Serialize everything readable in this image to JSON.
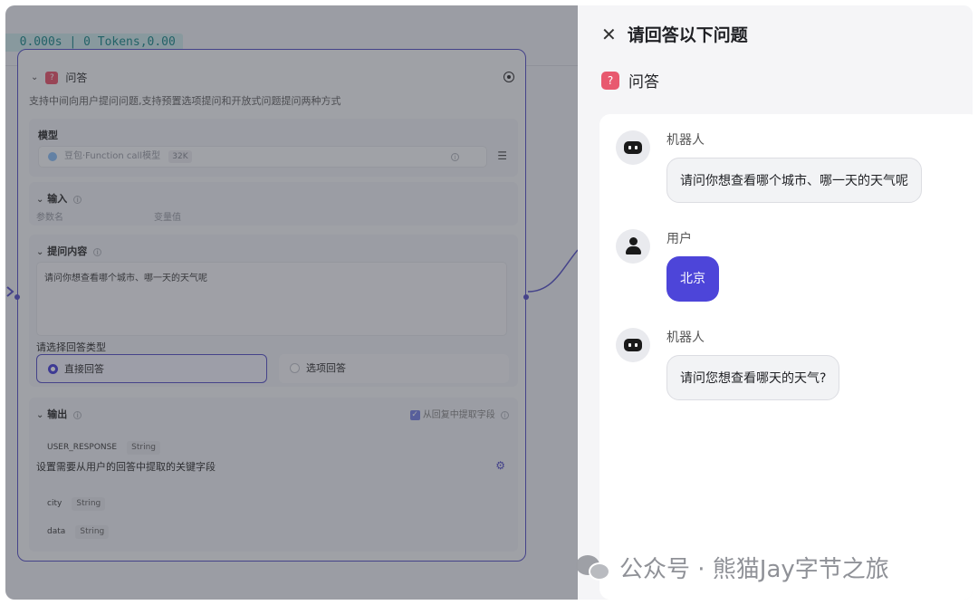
{
  "workflow": {
    "run_stats": "  0.000s | 0 Tokens,0.00",
    "node": {
      "title": "问答",
      "description": "支持中间向用户提问问题,支持预置选项提问和开放式问题提问两种方式",
      "model_section": {
        "title": "模型",
        "model_name": "豆包·Function call模型",
        "context_badge": "32K"
      },
      "input_section": {
        "title": "输入",
        "col_param": "参数名",
        "col_value": "变量值"
      },
      "prompt_section": {
        "title": "提问内容",
        "content": "请问你想查看哪个城市、哪一天的天气呢"
      },
      "answer_type": {
        "label": "请选择回答类型",
        "options": [
          {
            "label": "直接回答",
            "selected": true
          },
          {
            "label": "选项回答",
            "selected": false
          }
        ]
      },
      "output_section": {
        "title": "输出",
        "extract_toggle_label": "从回复中提取字段",
        "response_var": {
          "name": "USER_RESPONSE",
          "type": "String"
        },
        "extract_label": "设置需要从用户的回答中提取的关键字段",
        "fields": [
          {
            "name": "city",
            "type": "String"
          },
          {
            "name": "data",
            "type": "String"
          }
        ]
      }
    }
  },
  "drawer": {
    "title": "请回答以下问题",
    "subtitle": "问答",
    "messages": [
      {
        "role": "bot",
        "sender": "机器人",
        "text": "请问你想查看哪个城市、哪一天的天气呢"
      },
      {
        "role": "user",
        "sender": "用户",
        "text": "北京"
      },
      {
        "role": "bot",
        "sender": "机器人",
        "text": "请问您想查看哪天的天气?"
      }
    ]
  },
  "watermark": {
    "text": "公众号 · 熊猫Jay字节之旅"
  },
  "colors": {
    "accent": "#4d45d9",
    "node_border": "#5a55c9",
    "qa_icon": "#e8596f"
  }
}
